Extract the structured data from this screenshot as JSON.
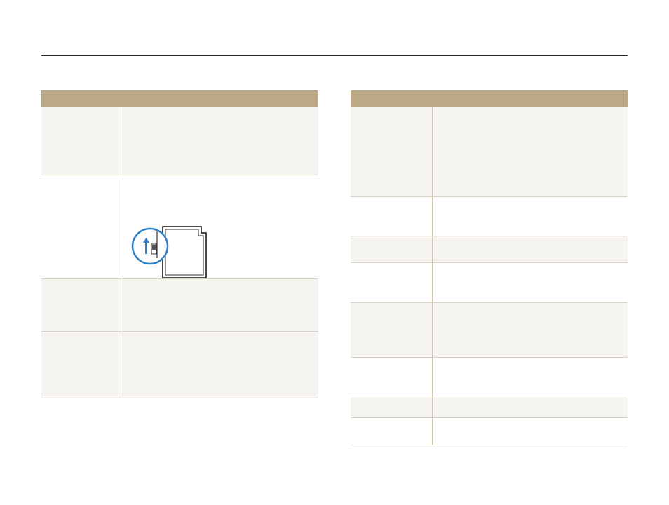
{
  "icons": {
    "sd_card": "sd-card-lock-switch-icon",
    "lock_arrow": "arrow-up-icon"
  },
  "colors": {
    "header_fill": "#bba985",
    "row_fill": "#f6f4f0",
    "divider": "#d9d2c2",
    "callout_blue": "#2e7dc8"
  }
}
